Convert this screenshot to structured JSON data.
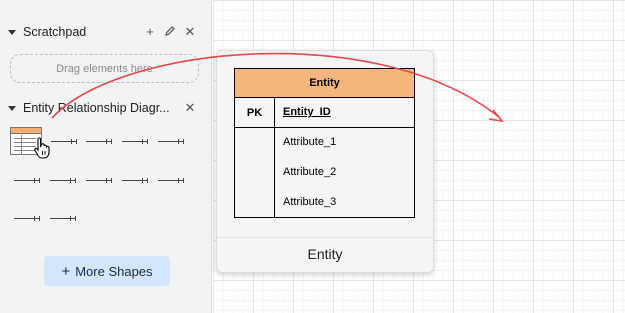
{
  "sidebar": {
    "scratchpad": {
      "title": "Scratchpad",
      "add_icon": "plus-icon",
      "edit_icon": "pencil-icon",
      "close_icon": "close-icon",
      "dropzone_text": "Drag elements here"
    },
    "er_section": {
      "title": "Entity Relationship Diagr...",
      "close_icon": "close-icon"
    },
    "more_shapes": {
      "label": "More Shapes",
      "icon": "plus-icon"
    }
  },
  "preview": {
    "entity": {
      "header": "Entity",
      "pk_label": "PK",
      "pk_field": "Entity_ID",
      "attributes": [
        "Attribute_1",
        "Attribute_2",
        "Attribute_3"
      ],
      "header_color": "#f4b67a"
    },
    "caption": "Entity"
  },
  "colors": {
    "arrow": "#e5484d",
    "sidebar_bg": "#f1f3f4",
    "button_bg": "#d3e6fb"
  }
}
